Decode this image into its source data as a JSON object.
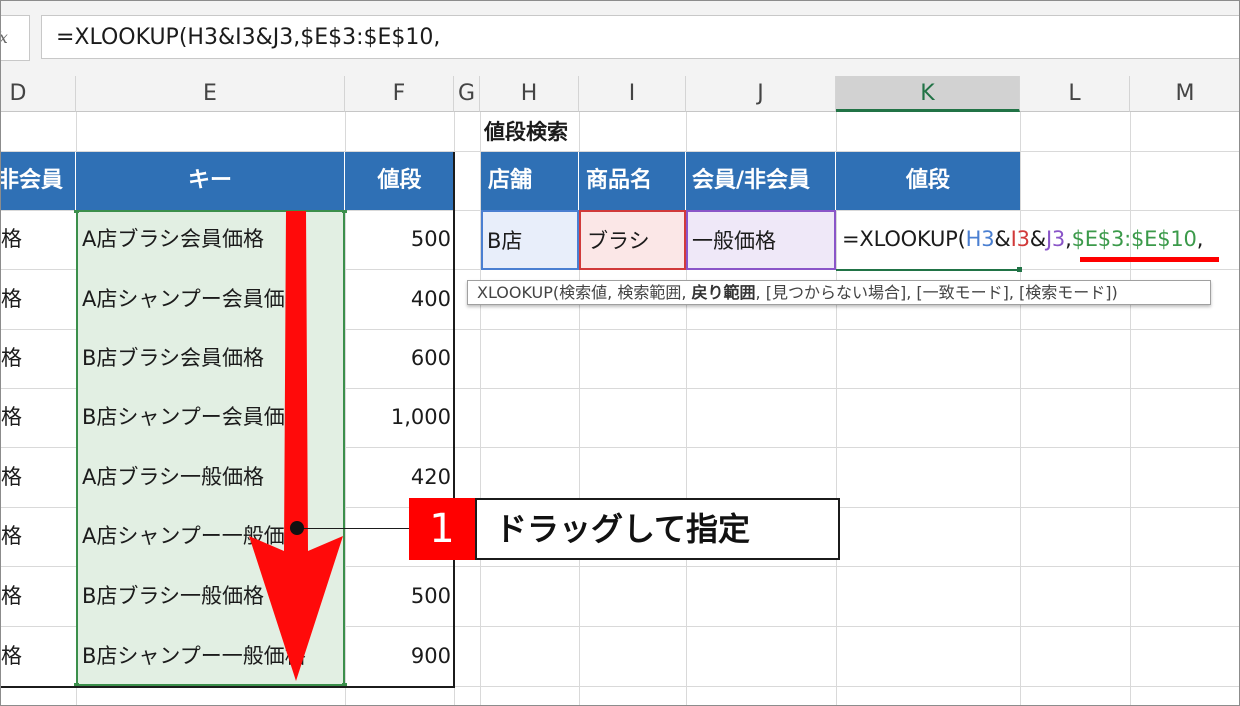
{
  "formula_bar": {
    "fx_label": "fx",
    "formula_text": "=XLOOKUP(H3&I3&J3,$E$3:$E$10,"
  },
  "columns": [
    {
      "letter": "D",
      "selected": false
    },
    {
      "letter": "E",
      "selected": false
    },
    {
      "letter": "F",
      "selected": false
    },
    {
      "letter": "G",
      "selected": false
    },
    {
      "letter": "H",
      "selected": false
    },
    {
      "letter": "I",
      "selected": false
    },
    {
      "letter": "J",
      "selected": false
    },
    {
      "letter": "K",
      "selected": true
    },
    {
      "letter": "L",
      "selected": false
    },
    {
      "letter": "M",
      "selected": false
    }
  ],
  "left_table": {
    "headers": {
      "d": "非会員",
      "e": "キー",
      "f": "値段"
    },
    "rows": [
      {
        "d": "格",
        "e": "A店ブラシ会員価格",
        "f": "500"
      },
      {
        "d": "格",
        "e": "A店シャンプー会員価格",
        "f": "400"
      },
      {
        "d": "格",
        "e": "B店ブラシ会員価格",
        "f": "600"
      },
      {
        "d": "格",
        "e": "B店シャンプー会員価格",
        "f": "1,000"
      },
      {
        "d": "格",
        "e": "A店ブラシ一般価格",
        "f": "420"
      },
      {
        "d": "格",
        "e": "A店シャンプー一般価格",
        "f": ""
      },
      {
        "d": "格",
        "e": "B店ブラシ一般価格",
        "f": "500"
      },
      {
        "d": "格",
        "e": "B店シャンプー一般価格",
        "f": "900"
      }
    ]
  },
  "search_table": {
    "title": "値段検索",
    "headers": {
      "h": "店舗",
      "i": "商品名",
      "j": "会員/非会員",
      "k": "値段"
    },
    "row": {
      "h": "B店",
      "i": "ブラシ",
      "j": "一般価格"
    },
    "formula_parts": {
      "prefix": "=XLOOKUP(",
      "ref1": "H3",
      "amp1": "&",
      "ref2": "I3",
      "amp2": "&",
      "ref3": "J3",
      "comma1": ",",
      "ref4": "$E$3:$E$10",
      "comma2": ","
    },
    "ref_colors": {
      "h3": "#4a7fd1",
      "i3": "#d13a3a",
      "j3": "#8a55c8",
      "range": "#3b9a4a"
    }
  },
  "tooltip": {
    "pre": "XLOOKUP(検索値, 検索範囲, ",
    "bold": "戻り範囲",
    "post": ", [見つからない場合], [一致モード], [検索モード])"
  },
  "callout": {
    "number": "1",
    "text": "ドラッグして指定"
  },
  "accent_colors": {
    "header_blue": "#2f70b5",
    "range_green": "#3b8f4b",
    "annotation_red": "#ff0000"
  }
}
